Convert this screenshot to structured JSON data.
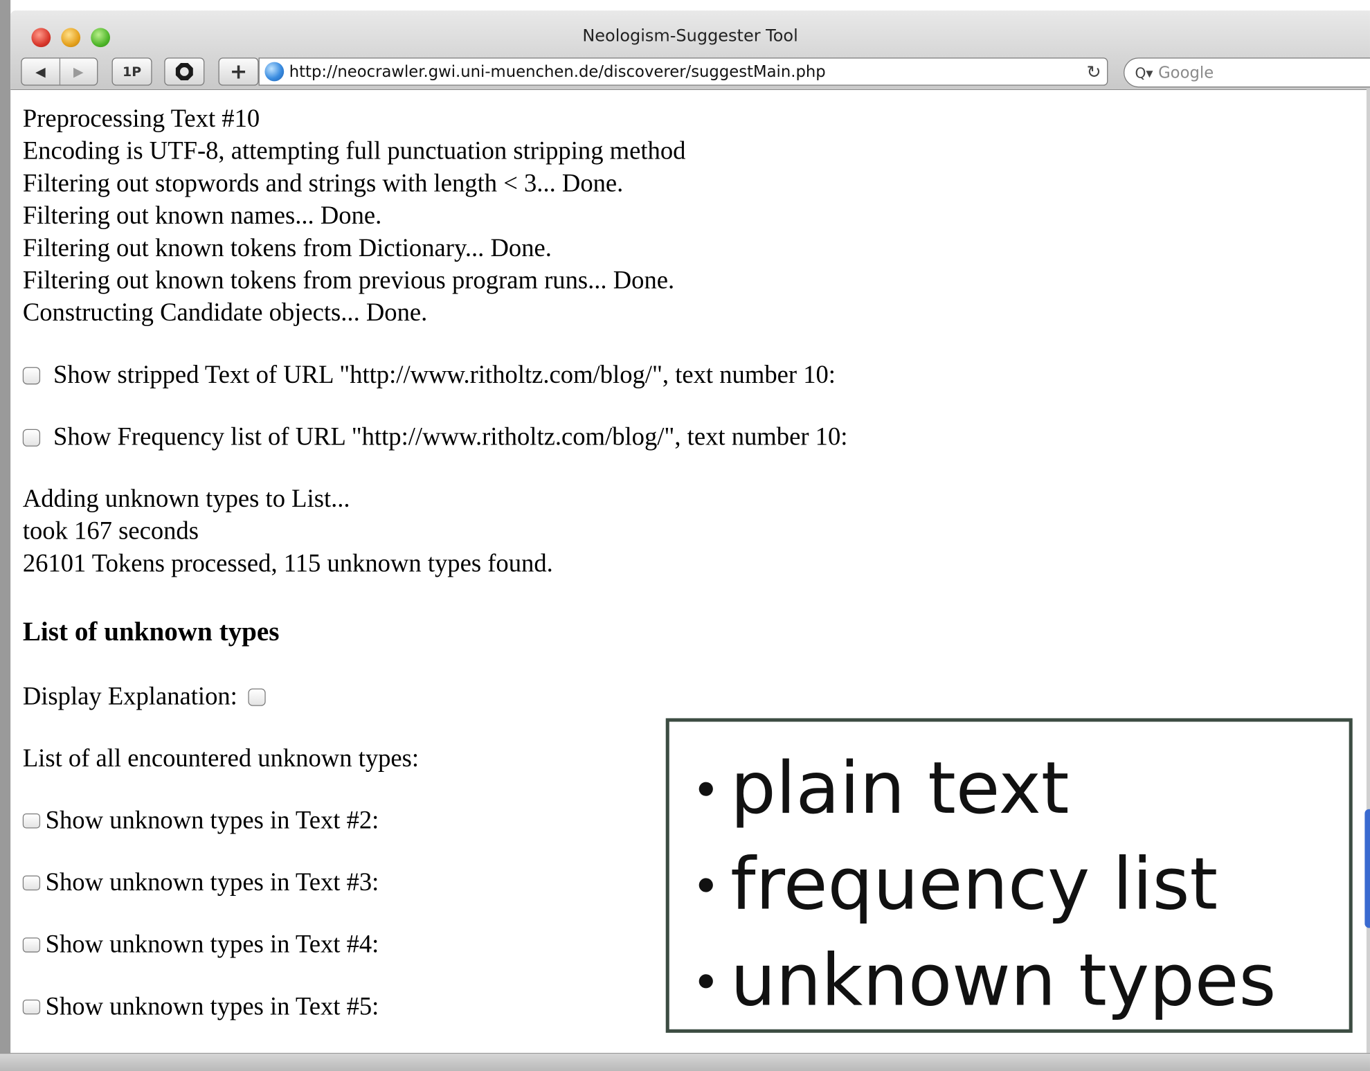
{
  "window": {
    "title": "Neologism-Suggester Tool"
  },
  "toolbar": {
    "back_glyph": "◀",
    "forward_glyph": "▶",
    "onepassword_label": "1P",
    "add_label": "+",
    "url": "http://neocrawler.gwi.uni-muenchen.de/discoverer/suggestMain.php",
    "reload_glyph": "↻",
    "search_placeholder": "Google",
    "search_icon_glyph": "Q▾"
  },
  "log": {
    "lines": [
      "Preprocessing Text #10",
      "Encoding is UTF-8, attempting full punctuation stripping method",
      "Filtering out stopwords and strings with length < 3... Done.",
      "Filtering out known names... Done.",
      "Filtering out known tokens from Dictionary... Done.",
      "Filtering out known tokens from previous program runs... Done.",
      "Constructing Candidate objects... Done."
    ]
  },
  "options": {
    "show_stripped": "Show stripped Text of URL \"http://www.ritholtz.com/blog/\", text number 10:",
    "show_frequency": "Show Frequency list of URL \"http://www.ritholtz.com/blog/\", text number 10:"
  },
  "summary": {
    "adding": "Adding unknown types to List...",
    "took": "took 167 seconds",
    "tokens": "26101 Tokens processed, 115 unknown types found."
  },
  "unknown_section": {
    "heading": "List of unknown types",
    "display_explanation": "Display Explanation:",
    "all_label": "List of all encountered unknown types:",
    "text_items": [
      "Show unknown types in Text #2:",
      "Show unknown types in Text #3:",
      "Show unknown types in Text #4:",
      "Show unknown types in Text #5:"
    ]
  },
  "overlay": {
    "items": [
      "plain text",
      "frequency list",
      "unknown types"
    ]
  },
  "colors": {
    "overlay_border": "#3c4c42",
    "close": "#d8372b",
    "minimize": "#e5a11d",
    "zoom": "#4fb62a"
  },
  "icons": {
    "globe": "globe-icon",
    "stop": "stop-octagon-icon",
    "reload": "reload-icon",
    "search": "search-icon"
  }
}
